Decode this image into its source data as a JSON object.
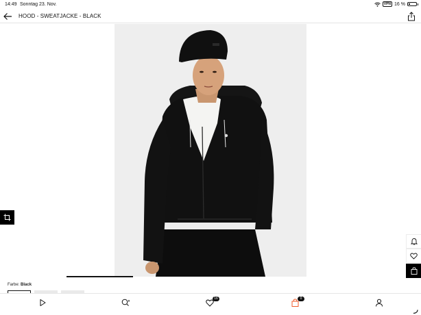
{
  "status_bar": {
    "time": "14:49",
    "date": "Sonntag 23. Nov.",
    "vpn": "VPN",
    "battery": "16 %",
    "battery_level": 0.16
  },
  "header": {
    "title": "HOOD - SWEATJACKE - BLACK",
    "back_icon": "arrow-left-icon",
    "share_icon": "share-icon"
  },
  "product": {
    "color_label": "Farbe:",
    "color_value": "Black",
    "swatches": [
      "black",
      "grey",
      "grey"
    ]
  },
  "tabbar": {
    "wishlist_count": "16",
    "cart_count": "0",
    "accent": "#f05a28"
  },
  "colors": {
    "background": "#ffffff",
    "image_bg": "#eeeeee",
    "text": "#111111"
  }
}
